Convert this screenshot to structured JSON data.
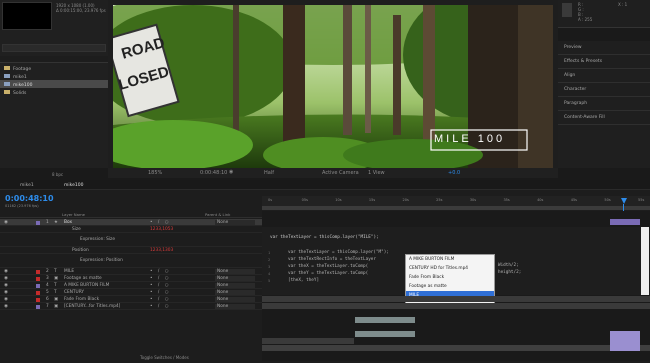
{
  "project": {
    "thumb_info": "1920 x 1080 (1.00)\nΔ 0:00:15:00, 23.976 fps",
    "tree": [
      {
        "label": "Footage",
        "type": "folder"
      },
      {
        "label": "mike1",
        "type": "comp"
      },
      {
        "label": "mike100",
        "type": "comp",
        "selected": true
      },
      {
        "label": "Solids",
        "type": "folder"
      }
    ],
    "bpc": "8 bpc"
  },
  "viewer": {
    "sign_text_1": "ROAD",
    "sign_text_2": "LOSED",
    "title_overlay": "MILE 100",
    "zoom": "185%",
    "timecode": "0:00:48:10",
    "resolution": "Half",
    "camera": "Active Camera",
    "views": "1 View"
  },
  "info_panel": {
    "lines": [
      "R :",
      "G :",
      "B :",
      "A : 255"
    ],
    "coord": "X : 1"
  },
  "right_panels": [
    "Preview",
    "Effects & Presets",
    "Align",
    "Character",
    "Paragraph",
    "Content-Aware Fill"
  ],
  "timeline": {
    "tabs": [
      "mike1",
      "mike100"
    ],
    "timecode": "0:00:48:10",
    "fps_info": "01162 (23.976 fps)",
    "col_layer_name": "Layer Name",
    "col_parent": "Parent & Link",
    "layers": [
      {
        "num": "1",
        "name": "Box",
        "parent": "None",
        "type": "shape",
        "selected": true
      },
      {
        "num": "",
        "name": "Size",
        "value": "1233,1053",
        "sub": true
      },
      {
        "num": "",
        "name": "Expression: Size",
        "sub2": true
      },
      {
        "num": "",
        "name": "Position",
        "value": "1233,1303",
        "sub": true
      },
      {
        "num": "",
        "name": "Expression: Position",
        "sub2": true
      },
      {
        "num": "2",
        "name": "MILE",
        "parent": "None",
        "type": "text"
      },
      {
        "num": "3",
        "name": "Footage as matte",
        "parent": "None",
        "type": "footage"
      },
      {
        "num": "4",
        "name": "A MIKE BURTON FILM",
        "parent": "None",
        "type": "text"
      },
      {
        "num": "5",
        "name": "CENTURY",
        "parent": "None",
        "type": "text"
      },
      {
        "num": "6",
        "name": "Fade From Black",
        "parent": "None",
        "type": "solid"
      },
      {
        "num": "7",
        "name": "[CENTURY...for Titles.mp4]",
        "parent": "None",
        "type": "footage"
      }
    ],
    "toggle_label": "Toggle Switches / Modes",
    "ruler_ticks": [
      "0s",
      "05s",
      "10s",
      "15s",
      "20s",
      "25s",
      "30s",
      "35s",
      "40s",
      "45s",
      "50s",
      "55s"
    ]
  },
  "code": {
    "line1": "var theTextLayer = thisComp.layer(\"MILE\");",
    "line2_lines": [
      "var theTextLayer = thisComp.layer(\"M\");",
      "var theTextRectInfo = theTextLayer",
      "var theX = theTextLayer.toComp(",
      "var theY = theTextLayer.toComp(",
      "[theX, theY]"
    ],
    "line_tail_1": "Width/2;",
    "line_tail_2": "height/2;"
  },
  "autocomplete": {
    "items": [
      "A MIKE BURTON FILM",
      "CENTURY HD for Titles.mp4",
      "Fade From Black",
      "Footage as matte",
      "MILE"
    ],
    "selected_index": 4
  },
  "colors": {
    "accent": "#2d8ceb",
    "label_red": "#c42b2b",
    "label_purple": "#7a6bb5",
    "label_lavender": "#9a8fd0"
  }
}
